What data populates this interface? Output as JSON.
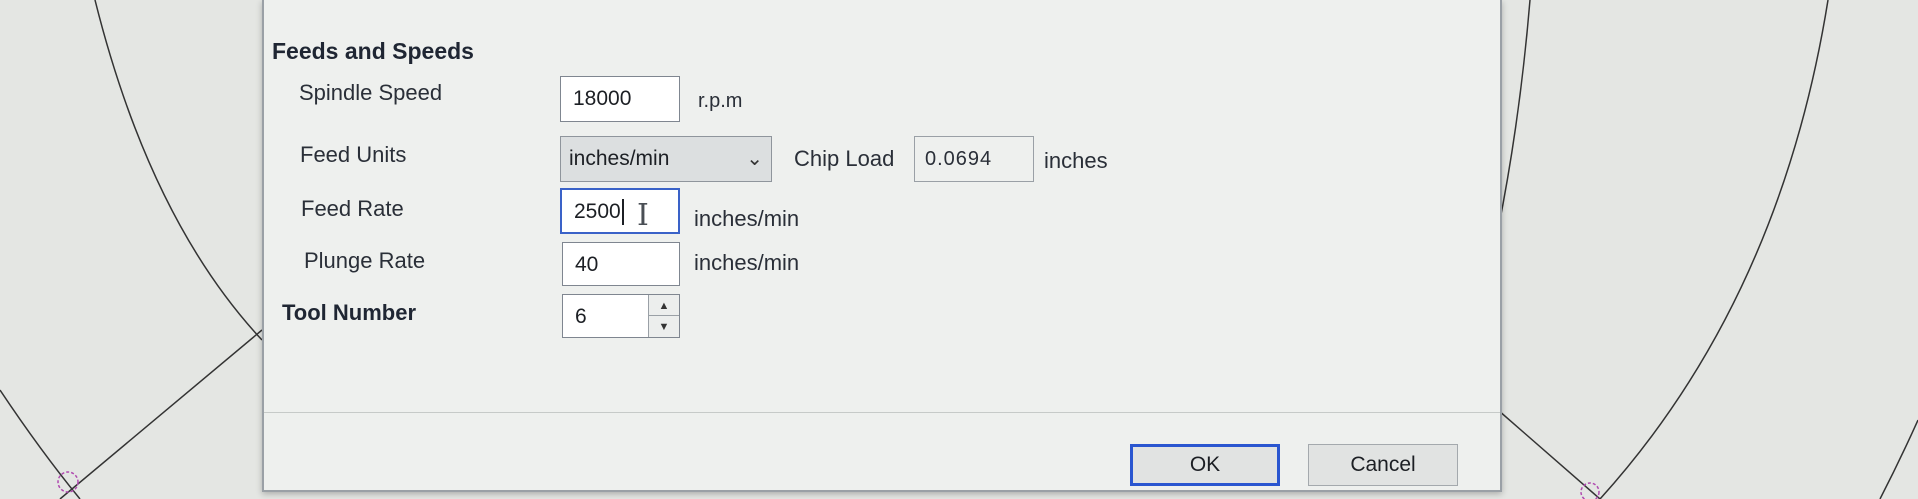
{
  "dialog": {
    "section_title": "Feeds and Speeds",
    "spindle_speed": {
      "label": "Spindle Speed",
      "value": "18000",
      "unit": "r.p.m"
    },
    "feed_units": {
      "label": "Feed Units",
      "selected": "inches/min"
    },
    "chip_load": {
      "label": "Chip Load",
      "value": "0.0694",
      "unit": "inches"
    },
    "feed_rate": {
      "label": "Feed Rate",
      "value": "2500",
      "unit": "inches/min"
    },
    "plunge_rate": {
      "label": "Plunge Rate",
      "value": "40",
      "unit": "inches/min"
    },
    "tool_number": {
      "label": "Tool Number",
      "value": "6"
    },
    "buttons": {
      "ok": "OK",
      "cancel": "Cancel"
    }
  },
  "colors": {
    "focus_blue": "#2a56d0",
    "dialog_bg": "#eef0ee",
    "canvas_bg": "#e4e6e3"
  },
  "icons": {
    "dropdown": "chevron-down-icon",
    "spin_up": "arrow-up-icon",
    "spin_down": "arrow-down-icon",
    "text_cursor": "i-beam-cursor-icon"
  }
}
